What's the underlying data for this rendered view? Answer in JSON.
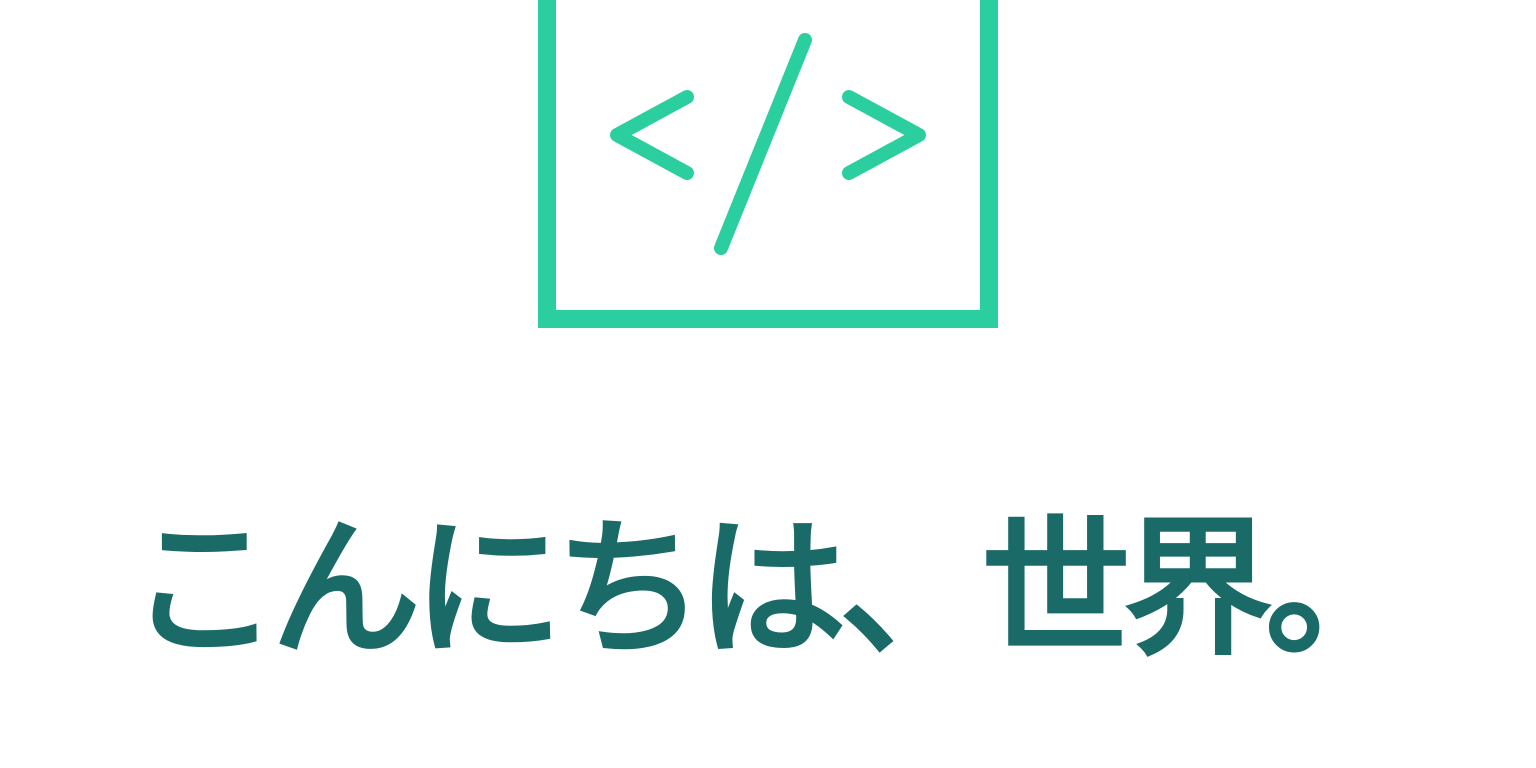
{
  "colors": {
    "accent": "#2bce9f",
    "text": "#1a6b68",
    "background": "#ffffff"
  },
  "logo": {
    "icon": "code-brackets-icon"
  },
  "headline": {
    "text": "こんにちは、世界。"
  }
}
